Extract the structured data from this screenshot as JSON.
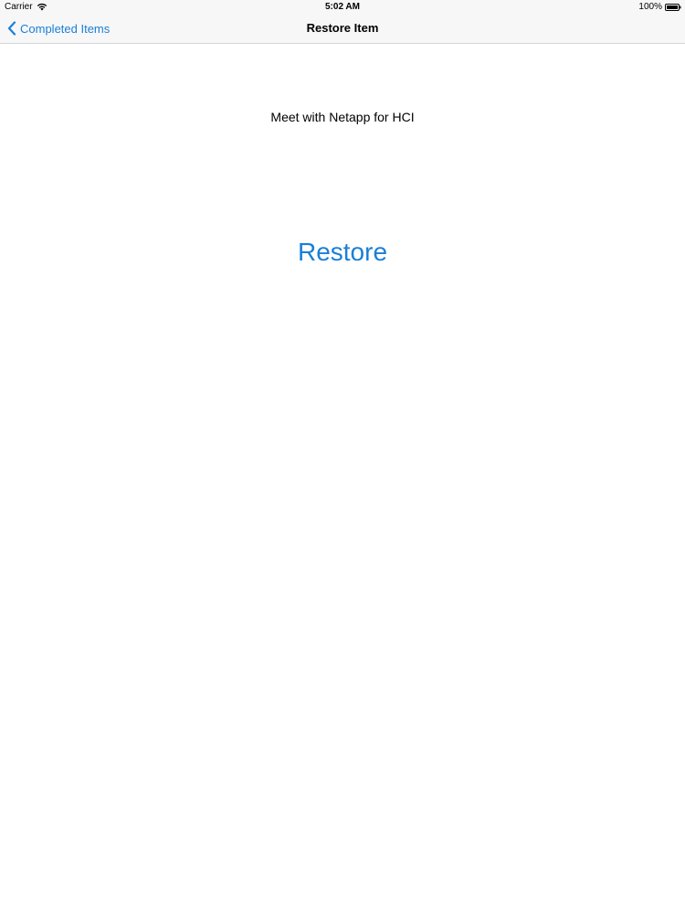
{
  "status_bar": {
    "carrier": "Carrier",
    "time": "5:02 AM",
    "battery": "100%",
    "wifi_icon": "wifi-icon",
    "battery_icon": "battery-icon"
  },
  "nav": {
    "back_label": "Completed Items",
    "back_icon": "chevron-left-icon",
    "title": "Restore Item"
  },
  "content": {
    "item_title": "Meet with Netapp for HCI",
    "restore_label": "Restore"
  },
  "colors": {
    "accent": "#1a7fd6",
    "bar_background": "#f7f7f8",
    "background": "#ffffff"
  }
}
